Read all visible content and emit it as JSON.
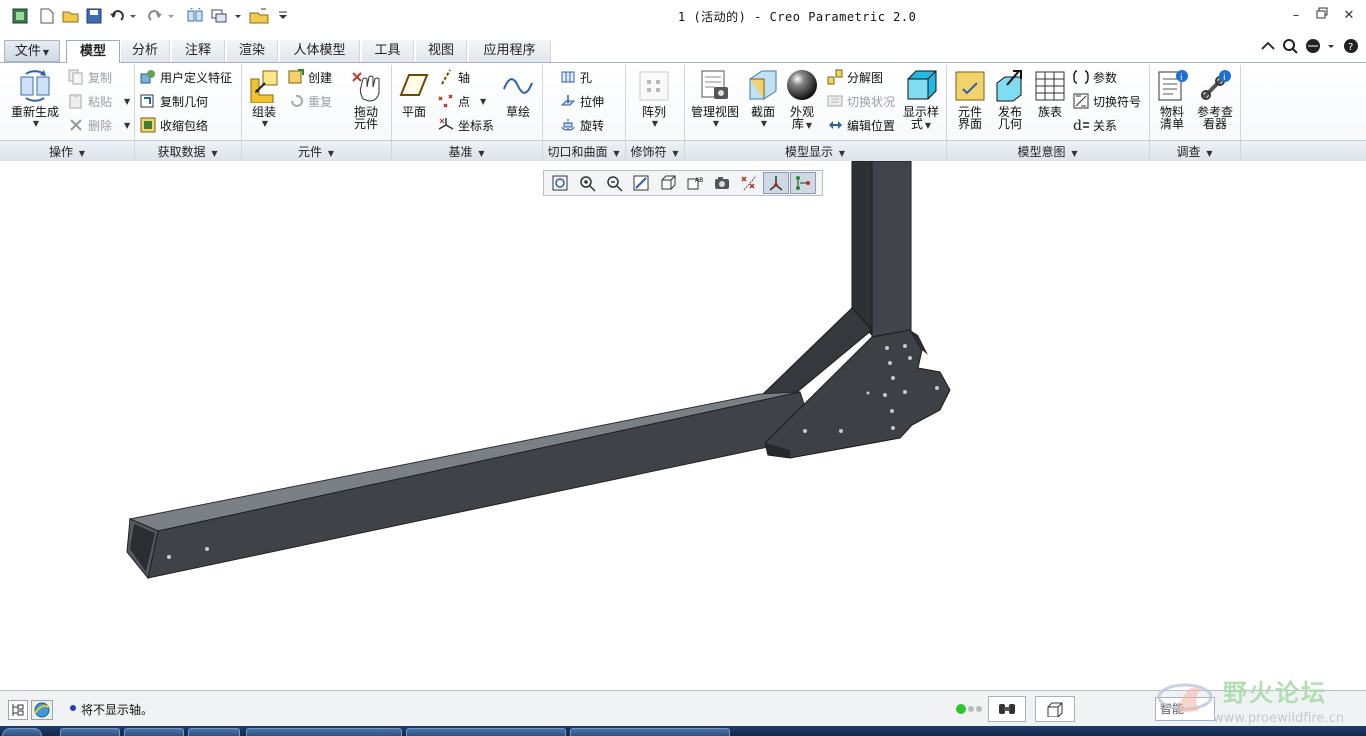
{
  "window": {
    "title": "1 (活动的) - Creo Parametric 2.0"
  },
  "tabs": [
    {
      "label": "文件"
    },
    {
      "label": "模型"
    },
    {
      "label": "分析"
    },
    {
      "label": "注释"
    },
    {
      "label": "渲染"
    },
    {
      "label": "人体模型"
    },
    {
      "label": "工具"
    },
    {
      "label": "视图"
    },
    {
      "label": "应用程序"
    }
  ],
  "ribbon": {
    "operations": {
      "group": "操作",
      "regenerate": [
        "重新生成"
      ],
      "copy": "复制",
      "paste": "粘贴",
      "delete": "删除"
    },
    "get_data": {
      "group": "获取数据",
      "udf": "用户定义特征",
      "copy_geom": "复制几何",
      "shrinkwrap": "收缩包络"
    },
    "component": {
      "group": "元件",
      "assemble": "组装",
      "create": "创建",
      "repeat": "重复",
      "drag": [
        "拖动",
        "元件"
      ]
    },
    "datum": {
      "group": "基准",
      "plane": "平面",
      "axis": "轴",
      "point": "点",
      "csys": "坐标系",
      "sketch": "草绘"
    },
    "cut_surface": {
      "group": "切口和曲面",
      "hole": "孔",
      "extrude": "拉伸",
      "revolve": "旋转"
    },
    "modifiers": {
      "group": "修饰符",
      "pattern": "阵列"
    },
    "model_display": {
      "group": "模型显示",
      "manage_views": "管理视图",
      "section": "截面",
      "appearance": [
        "外观",
        "库"
      ],
      "explode": "分解图",
      "toggle_status": "切换状况",
      "edit_position": "编辑位置",
      "display_style": [
        "显示样",
        "式"
      ]
    },
    "model_intent": {
      "group": "模型意图",
      "comp_interface": [
        "元件",
        "界面"
      ],
      "publish_geom": [
        "发布",
        "几何"
      ],
      "family_table": "族表",
      "parameters": "参数",
      "switch_symbols": "切换符号",
      "relations": "关系"
    },
    "investigate": {
      "group": "调查",
      "bom": [
        "物料",
        "清单"
      ],
      "ref_viewer": [
        "参考查",
        "看器"
      ]
    }
  },
  "view_toolbar": {
    "items": [
      "refit-icon",
      "zoom-in-icon",
      "zoom-out-icon",
      "repaint-icon",
      "display-style-icon",
      "saved-views-icon",
      "view-manager-icon",
      "datum-display-icon",
      "spin-center-icon",
      "annotation-display-icon"
    ]
  },
  "status": {
    "message": "将不显示轴。",
    "filter": "智能"
  },
  "watermark": {
    "title": "野火论坛",
    "url": "www.proewildfire.cn"
  },
  "colors": {
    "model_face": "#3f4247",
    "model_top": "#7b8087",
    "ribbon_tab_active": "#ffffff"
  }
}
